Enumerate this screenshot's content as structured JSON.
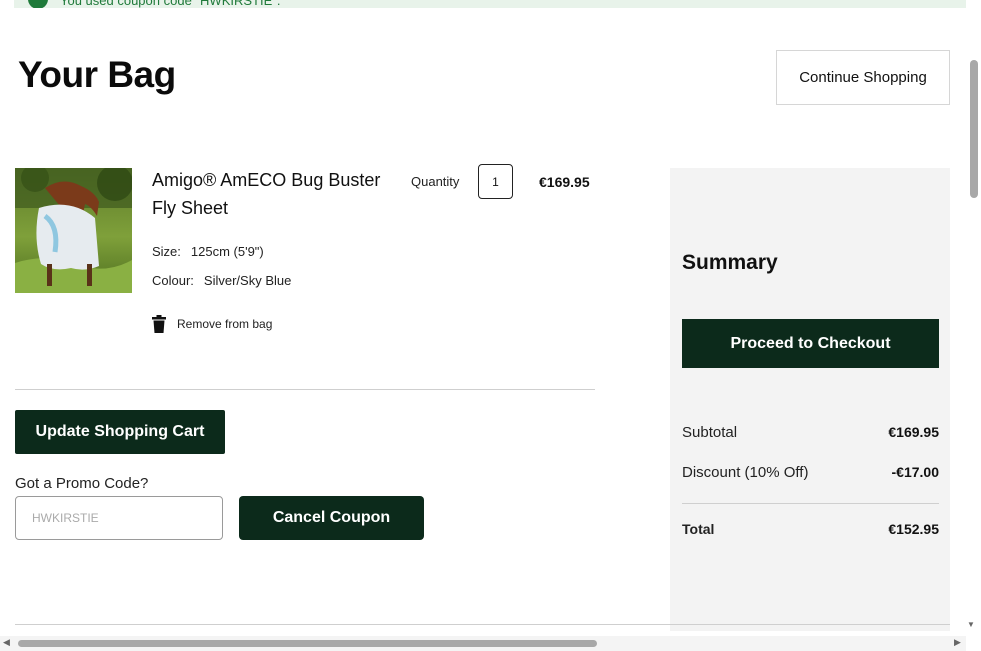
{
  "banner": {
    "message": "You used coupon code \"HWKIRSTIE\"."
  },
  "header": {
    "title": "Your Bag",
    "continue_label": "Continue Shopping"
  },
  "item": {
    "name": "Amigo® AmECO Bug Buster Fly Sheet",
    "quantity_label": "Quantity",
    "quantity": "1",
    "price": "€169.95",
    "size_label": "Size:",
    "size_value": "125cm (5'9\")",
    "colour_label": "Colour:",
    "colour_value": "Silver/Sky Blue",
    "remove_label": "Remove from bag"
  },
  "cart": {
    "update_label": "Update Shopping Cart",
    "promo_label": "Got a Promo Code?",
    "promo_value": "HWKIRSTIE",
    "cancel_label": "Cancel Coupon"
  },
  "summary": {
    "title": "Summary",
    "checkout_label": "Proceed to Checkout",
    "subtotal_label": "Subtotal",
    "subtotal_value": "€169.95",
    "discount_label": "Discount (10% Off)",
    "discount_value": "-€17.00",
    "total_label": "Total",
    "total_value": "€152.95"
  },
  "icons": {
    "banner": "check-icon",
    "remove": "trash-icon",
    "product": "horse-fly-sheet-photo"
  },
  "colors": {
    "primary": "#0c2a1b",
    "banner_bg": "#e8f3ea",
    "success": "#1f7a3a",
    "summary_bg": "#f3f3f3"
  }
}
